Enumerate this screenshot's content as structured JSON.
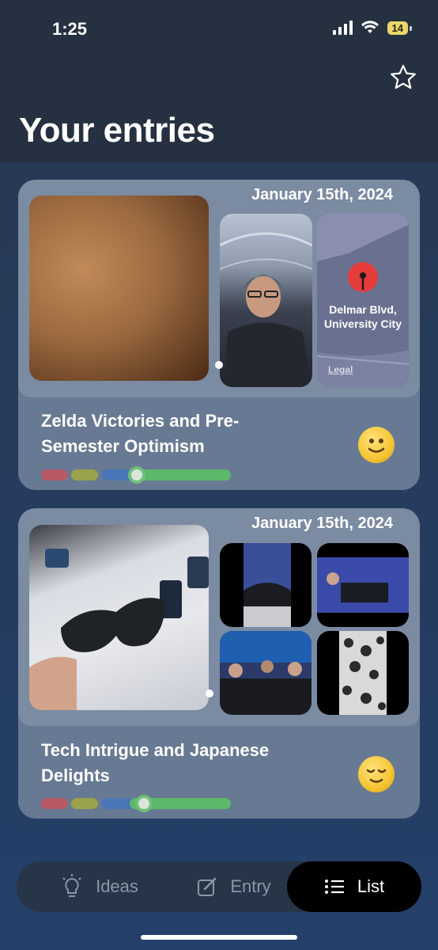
{
  "status_bar": {
    "time": "1:25",
    "battery": "14"
  },
  "header": {
    "title": "Your entries",
    "favorite_icon": "star-outline-icon"
  },
  "entries": [
    {
      "date": "January 15th, 2024",
      "title": "Zelda Victories and Pre-Semester Optimism",
      "map": {
        "label_line1": "Delmar Blvd,",
        "label_line2": "University City",
        "legal": "Legal"
      },
      "emoji_icon": "slightly-smiling-face-icon",
      "mood_position": 0.5
    },
    {
      "date": "January 15th, 2024",
      "title": "Tech Intrigue and Japanese Delights",
      "emoji_icon": "relieved-face-icon",
      "mood_position": 0.54
    }
  ],
  "tabs": [
    {
      "label": "Ideas",
      "icon": "lightbulb-icon",
      "active": false
    },
    {
      "label": "Entry",
      "icon": "compose-icon",
      "active": false
    },
    {
      "label": "List",
      "icon": "list-icon",
      "active": true
    }
  ],
  "colors": {
    "mood_red": "#b85a66",
    "mood_olive": "#9aa24a",
    "mood_blue": "#4a76b8",
    "mood_green": "#5cb86a",
    "tab_active": "#000000",
    "map_pin": "#e53b3b"
  }
}
